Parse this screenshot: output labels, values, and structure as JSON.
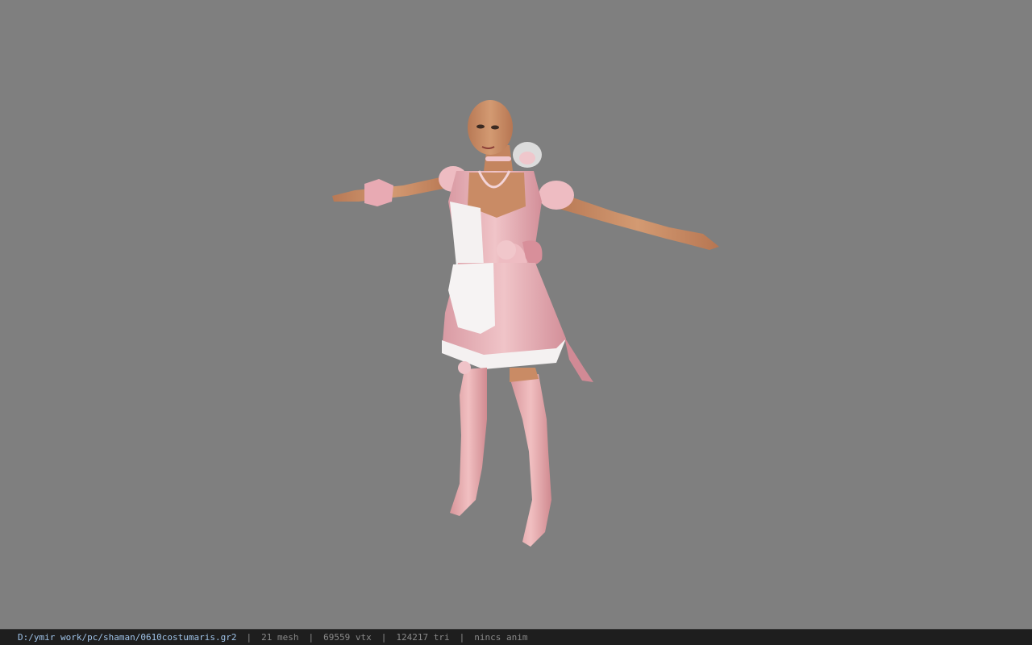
{
  "viewer": {
    "background_color": "#7f7f7f",
    "model_name": "shaman character model",
    "model_colors": {
      "skin": "#c98b65",
      "dress": "#e9b7bd",
      "apron": "#f4f1f1",
      "boots": "#e8aeb0"
    }
  },
  "status": {
    "path": "D:/ymir work/pc/shaman/0610costumaris.gr2",
    "mesh": "21 mesh",
    "vtx": "69559 vtx",
    "tri": "124217 tri",
    "anim": "nincs anim",
    "sep": "|"
  }
}
